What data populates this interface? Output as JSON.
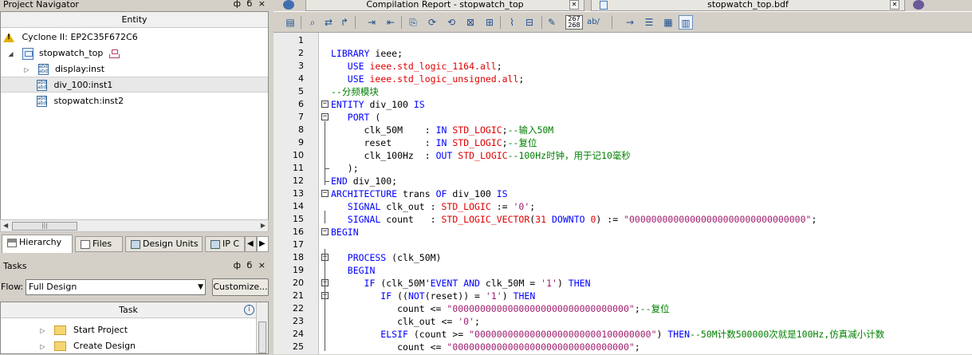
{
  "project_navigator": {
    "title": "Project Navigator",
    "window_controls": "ф б ×",
    "column_header": "Entity",
    "items": [
      {
        "label": "Cyclone II: EP2C35F672C6"
      },
      {
        "label": "stopwatch_top"
      },
      {
        "label": "display:inst"
      },
      {
        "label": "div_100:inst1"
      },
      {
        "label": "stopwatch:inst2"
      }
    ],
    "tabs": [
      {
        "label": "Hierarchy"
      },
      {
        "label": "Files"
      },
      {
        "label": "Design Units"
      },
      {
        "label": "IP C"
      }
    ]
  },
  "tasks": {
    "title": "Tasks",
    "flow_label": "Flow:",
    "flow_value": "Full Design",
    "customize_label": "Customize...",
    "column_header": "Task",
    "items": [
      {
        "label": "Start Project"
      },
      {
        "label": "Create Design"
      }
    ]
  },
  "document_tabs": [
    {
      "label": "Compilation Report - stopwatch_top"
    },
    {
      "label": "stopwatch_top.bdf"
    }
  ],
  "toolbar": {
    "line_count_top": "267",
    "line_count_bottom": "268"
  },
  "editor": {
    "lines": [
      {
        "n": "1",
        "parts": []
      },
      {
        "n": "2",
        "parts": [
          {
            "t": "LIBRARY",
            "c": "kw"
          },
          {
            "t": " ieee;",
            "c": ""
          }
        ]
      },
      {
        "n": "3",
        "parts": [
          {
            "t": "   USE ",
            "c": "kw"
          },
          {
            "t": "ieee.std_logic_1164.all",
            "c": "ty"
          },
          {
            "t": ";",
            "c": ""
          }
        ]
      },
      {
        "n": "4",
        "parts": [
          {
            "t": "   USE ",
            "c": "kw"
          },
          {
            "t": "ieee.std_logic_unsigned.all",
            "c": "ty"
          },
          {
            "t": ";",
            "c": ""
          }
        ]
      },
      {
        "n": "5",
        "parts": [
          {
            "t": "--分频模块",
            "c": "cm"
          }
        ]
      },
      {
        "n": "6",
        "parts": [
          {
            "t": "ENTITY",
            "c": "kw"
          },
          {
            "t": " div_100 ",
            "c": ""
          },
          {
            "t": "IS",
            "c": "kw"
          }
        ]
      },
      {
        "n": "7",
        "parts": [
          {
            "t": "   PORT",
            "c": "kw"
          },
          {
            "t": " (",
            "c": ""
          }
        ]
      },
      {
        "n": "8",
        "parts": [
          {
            "t": "      clk_50M    : ",
            "c": ""
          },
          {
            "t": "IN",
            "c": "kw"
          },
          {
            "t": " ",
            "c": ""
          },
          {
            "t": "STD_LOGIC",
            "c": "ty"
          },
          {
            "t": ";",
            "c": ""
          },
          {
            "t": "--输入50M",
            "c": "cm"
          }
        ]
      },
      {
        "n": "9",
        "parts": [
          {
            "t": "      reset      : ",
            "c": ""
          },
          {
            "t": "IN",
            "c": "kw"
          },
          {
            "t": " ",
            "c": ""
          },
          {
            "t": "STD_LOGIC",
            "c": "ty"
          },
          {
            "t": ";",
            "c": ""
          },
          {
            "t": "--复位",
            "c": "cm"
          }
        ]
      },
      {
        "n": "10",
        "parts": [
          {
            "t": "      clk_100Hz  : ",
            "c": ""
          },
          {
            "t": "OUT",
            "c": "kw"
          },
          {
            "t": " ",
            "c": ""
          },
          {
            "t": "STD_LOGIC",
            "c": "ty"
          },
          {
            "t": "--100Hz时钟，用于记10毫秒",
            "c": "cm"
          }
        ]
      },
      {
        "n": "11",
        "parts": [
          {
            "t": "   );",
            "c": ""
          }
        ]
      },
      {
        "n": "12",
        "parts": [
          {
            "t": "END",
            "c": "kw"
          },
          {
            "t": " div_100;",
            "c": ""
          }
        ]
      },
      {
        "n": "13",
        "parts": [
          {
            "t": "ARCHITECTURE",
            "c": "kw"
          },
          {
            "t": " trans ",
            "c": ""
          },
          {
            "t": "OF",
            "c": "kw"
          },
          {
            "t": " div_100 ",
            "c": ""
          },
          {
            "t": "IS",
            "c": "kw"
          }
        ]
      },
      {
        "n": "14",
        "parts": [
          {
            "t": "   SIGNAL",
            "c": "kw"
          },
          {
            "t": " clk_out : ",
            "c": ""
          },
          {
            "t": "STD_LOGIC",
            "c": "ty"
          },
          {
            "t": " := ",
            "c": ""
          },
          {
            "t": "'0'",
            "c": "st"
          },
          {
            "t": ";",
            "c": ""
          }
        ]
      },
      {
        "n": "15",
        "parts": [
          {
            "t": "   SIGNAL",
            "c": "kw"
          },
          {
            "t": " count   : ",
            "c": ""
          },
          {
            "t": "STD_LOGIC_VECTOR",
            "c": "ty"
          },
          {
            "t": "(",
            "c": ""
          },
          {
            "t": "31",
            "c": "nm"
          },
          {
            "t": " ",
            "c": ""
          },
          {
            "t": "DOWNTO",
            "c": "kw"
          },
          {
            "t": " ",
            "c": ""
          },
          {
            "t": "0",
            "c": "nm"
          },
          {
            "t": ") := ",
            "c": ""
          },
          {
            "t": "\"00000000000000000000000000000000\"",
            "c": "st"
          },
          {
            "t": ";",
            "c": ""
          }
        ]
      },
      {
        "n": "16",
        "parts": [
          {
            "t": "BEGIN",
            "c": "kw"
          }
        ]
      },
      {
        "n": "17",
        "parts": []
      },
      {
        "n": "18",
        "parts": [
          {
            "t": "   PROCESS",
            "c": "kw"
          },
          {
            "t": " (clk_50M)",
            "c": ""
          }
        ]
      },
      {
        "n": "19",
        "parts": [
          {
            "t": "   BEGIN",
            "c": "kw"
          }
        ]
      },
      {
        "n": "20",
        "parts": [
          {
            "t": "      IF",
            "c": "kw"
          },
          {
            "t": " (clk_50M'",
            "c": ""
          },
          {
            "t": "EVENT",
            "c": "kw"
          },
          {
            "t": " ",
            "c": ""
          },
          {
            "t": "AND",
            "c": "kw"
          },
          {
            "t": " clk_50M = ",
            "c": ""
          },
          {
            "t": "'1'",
            "c": "st"
          },
          {
            "t": ") ",
            "c": ""
          },
          {
            "t": "THEN",
            "c": "kw"
          }
        ]
      },
      {
        "n": "21",
        "parts": [
          {
            "t": "         IF",
            "c": "kw"
          },
          {
            "t": " ((",
            "c": ""
          },
          {
            "t": "NOT",
            "c": "kw"
          },
          {
            "t": "(reset)) = ",
            "c": ""
          },
          {
            "t": "'1'",
            "c": "st"
          },
          {
            "t": ") ",
            "c": ""
          },
          {
            "t": "THEN",
            "c": "kw"
          }
        ]
      },
      {
        "n": "22",
        "parts": [
          {
            "t": "            count <= ",
            "c": ""
          },
          {
            "t": "\"00000000000000000000000000000000\"",
            "c": "st"
          },
          {
            "t": ";",
            "c": ""
          },
          {
            "t": "--复位",
            "c": "cm"
          }
        ]
      },
      {
        "n": "23",
        "parts": [
          {
            "t": "            clk_out <= ",
            "c": ""
          },
          {
            "t": "'0'",
            "c": "st"
          },
          {
            "t": ";",
            "c": ""
          }
        ]
      },
      {
        "n": "24",
        "parts": [
          {
            "t": "         ELSIF",
            "c": "kw"
          },
          {
            "t": " (count >= ",
            "c": ""
          },
          {
            "t": "\"00000000000000000000000100000000\"",
            "c": "st"
          },
          {
            "t": ") ",
            "c": ""
          },
          {
            "t": "THEN",
            "c": "kw"
          },
          {
            "t": "--50M计数500000次就是100Hz,仿真减小计数",
            "c": "cm"
          }
        ]
      },
      {
        "n": "25",
        "parts": [
          {
            "t": "            count <= ",
            "c": ""
          },
          {
            "t": "\"00000000000000000000000000000000\"",
            "c": "st"
          },
          {
            "t": ";",
            "c": ""
          }
        ]
      }
    ]
  }
}
